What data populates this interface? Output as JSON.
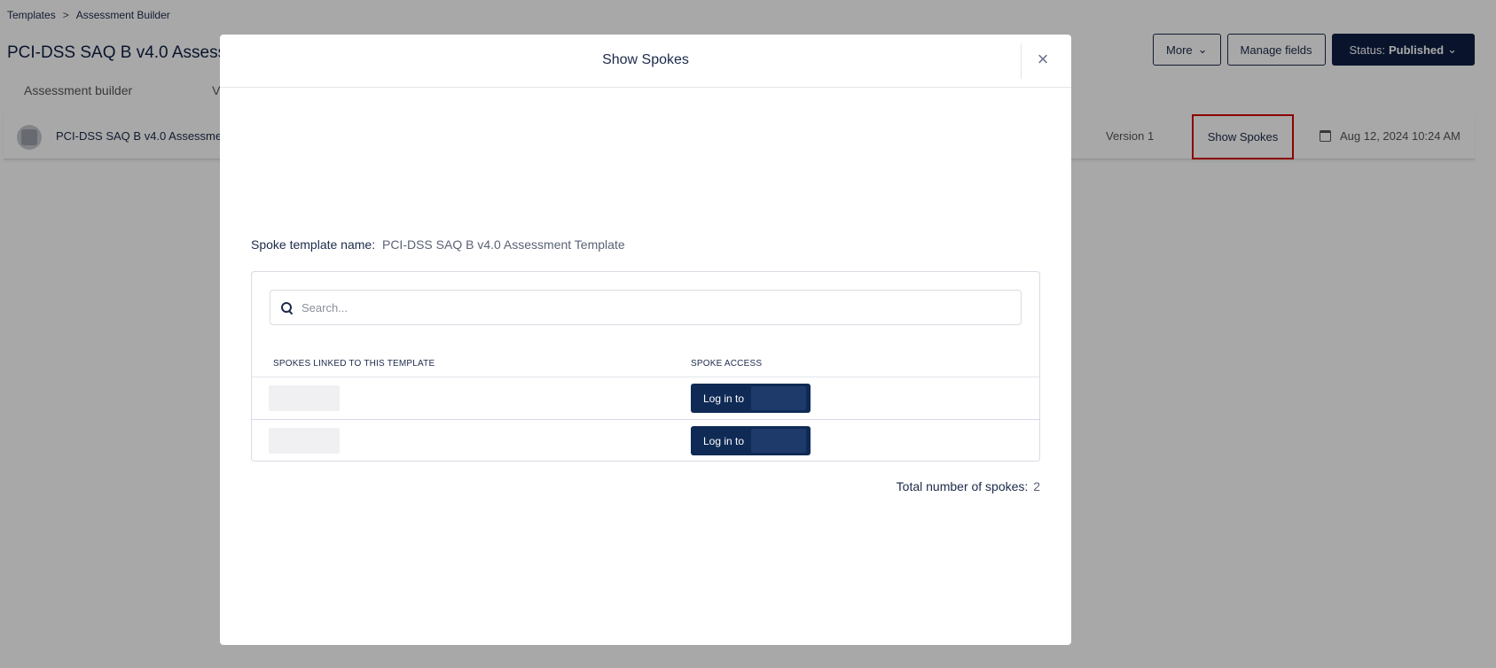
{
  "breadcrumb": {
    "items": [
      "Templates",
      "Assessment Builder"
    ],
    "separator": ">"
  },
  "page": {
    "title": "PCI-DSS SAQ B v4.0 Assessm",
    "more_label": "More",
    "manage_fields_label": "Manage fields",
    "status_prefix": "Status:",
    "status_value": "Published",
    "tabs": [
      "Assessment builder",
      "Ver"
    ]
  },
  "row": {
    "name": "PCI-DSS SAQ B v4.0 Assessmen",
    "version": "Version 1",
    "show_spokes": "Show Spokes",
    "date": "Aug 12, 2024 10:24 AM"
  },
  "modal": {
    "title": "Show Spokes",
    "close_glyph": "×",
    "spoke_template_label": "Spoke template name:",
    "spoke_template_value": "PCI-DSS SAQ B v4.0 Assessment Template",
    "search_placeholder": "Search...",
    "columns": [
      "SPOKES LINKED TO THIS TEMPLATE",
      "SPOKE ACCESS"
    ],
    "rows": [
      {
        "login_label": "Log in to"
      },
      {
        "login_label": "Log in to"
      }
    ],
    "total_label": "Total number of spokes:",
    "total_value": "2"
  },
  "colors": {
    "primary": "#0f1f44",
    "highlight": "#d40000"
  }
}
